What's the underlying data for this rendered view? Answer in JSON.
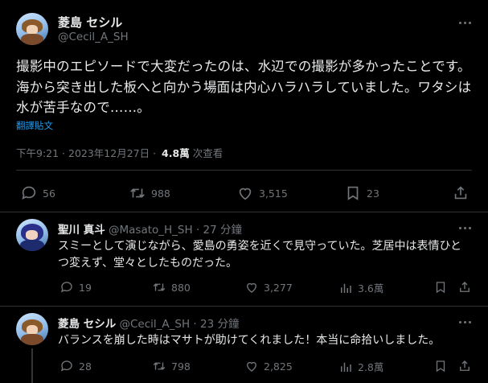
{
  "main_post": {
    "display_name": "菱島 セシル",
    "handle": "@Cecil_A_SH",
    "text": "撮影中のエピソードで大変だったのは、水辺での撮影が多かったことです。海から突き出した板へと向かう場面は内心ハラハラしていました。ワタシは水が苦手なので……。",
    "translate_label": "翻譯貼文",
    "time": "下午9:21 · 2023年12月27日 ·",
    "views_count": "4.8萬",
    "views_label": "次查看",
    "replies": "56",
    "reposts": "988",
    "likes": "3,515",
    "bookmarks": "23"
  },
  "replies": [
    {
      "display_name": "聖川 真斗",
      "handle": "@Masato_H_SH",
      "time": "· 27 分鐘",
      "text": "スミーとして演じながら、愛島の勇姿を近くで見守っていた。芝居中は表情ひとつ変えず、堂々としたものだった。",
      "replies": "19",
      "reposts": "880",
      "likes": "3,277",
      "views": "3.6萬"
    },
    {
      "display_name": "菱島 セシル",
      "handle": "@Cecil_A_SH",
      "time": "· 23 分鐘",
      "text": "バランスを崩した時はマサトが助けてくれました！本当に命拾いしました。",
      "replies": "28",
      "reposts": "798",
      "likes": "2,825",
      "views": "2.8萬"
    }
  ],
  "colors": {
    "background": "#000000",
    "text": "#e7e9ea",
    "muted": "#71767b",
    "link": "#1d9bf0",
    "divider": "#2f3336"
  }
}
